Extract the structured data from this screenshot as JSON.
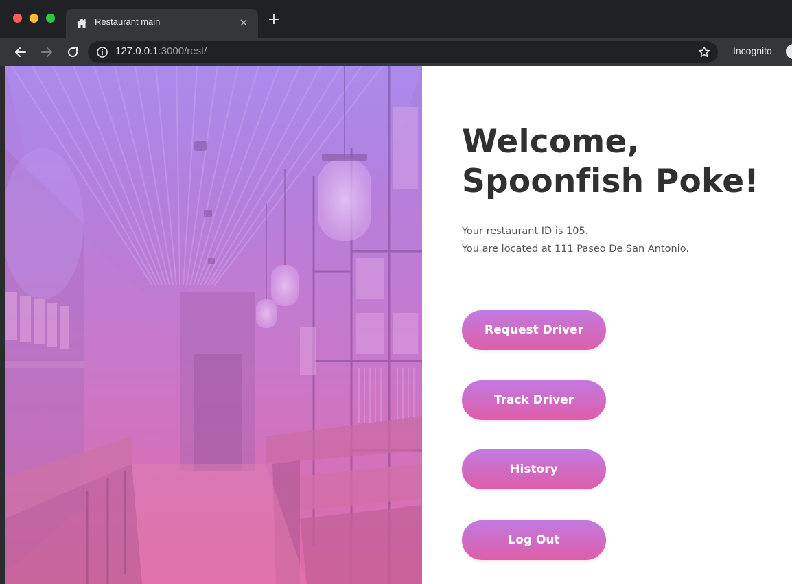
{
  "browser": {
    "tab_title": "Restaurant main",
    "tab_close": "×",
    "new_tab": "+",
    "url_host": "127.0.0.1",
    "url_rest": ":3000/rest/",
    "incognito_label": "Incognito"
  },
  "page": {
    "welcome": "Welcome, Spoonfish Poke!",
    "restaurant_id_line": "Your restaurant ID is 105.",
    "location_line": "You are located at 111 Paseo De San Antonio."
  },
  "actions": {
    "request_driver": "Request Driver",
    "track_driver": "Track Driver",
    "history": "History",
    "log_out": "Log Out"
  },
  "colors": {
    "button_gradient_top": "#c27ae2",
    "button_gradient_bottom": "#de5ea8",
    "hero_overlay_top": "#a784e8",
    "hero_overlay_bottom": "#e06aa8",
    "heading_text": "#303030",
    "chrome_dark": "#202124",
    "chrome_toolbar": "#35363a"
  },
  "icons": {
    "tab_favicon": "home-icon",
    "back": "arrow-left-icon",
    "forward": "arrow-right-icon",
    "reload": "reload-icon",
    "site_info": "info-icon",
    "bookmark": "star-icon"
  }
}
